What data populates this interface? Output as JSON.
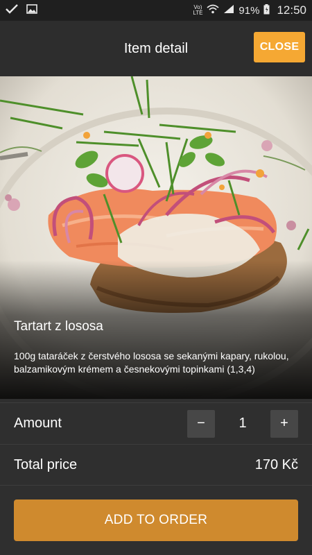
{
  "status_bar": {
    "network_label": "Vo)\nLTE",
    "battery": "91%",
    "time": "12:50"
  },
  "header": {
    "title": "Item detail",
    "close_label": "CLOSE"
  },
  "item": {
    "name": "Tartart z lososa",
    "description": "100g tataráček z čerstvého lososa se sekanými kapary, rukolou, balzamikovým krémem a česnekovými topinkami (1,3,4)"
  },
  "amount": {
    "label": "Amount",
    "value": "1",
    "minus": "−",
    "plus": "+"
  },
  "total": {
    "label": "Total price",
    "value": "170 Kč"
  },
  "add_button_label": "ADD TO ORDER",
  "colors": {
    "accent": "#f5a833",
    "add_button": "#cf8a2e",
    "background": "#2f2f2f"
  }
}
